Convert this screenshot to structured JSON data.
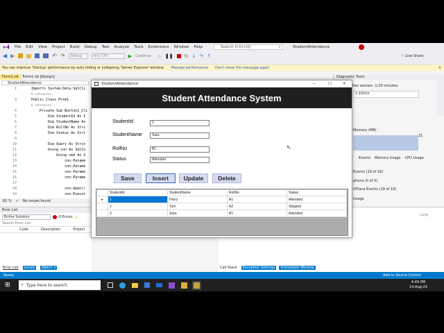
{
  "ide": {
    "menu": [
      "File",
      "Edit",
      "View",
      "Project",
      "Build",
      "Debug",
      "Test",
      "Analyze",
      "Tools",
      "Extensions",
      "Window",
      "Help"
    ],
    "search_placeholder": "Search (Ctrl+Q)",
    "solution_title": "StudentAttendance",
    "live_share": "Live Share",
    "config": "Debug",
    "platform": "Any CPU",
    "continue_label": "Continue",
    "infobar": {
      "message": "You can improve 'Startup' performance by auto hiding or collapsing 'Server Explorer' window.",
      "link1": "Manage performance",
      "link2": "Don't show this message again"
    },
    "tabs": [
      "Form1.vb",
      "Form1.vb [Design]"
    ],
    "code_dropdown": "StudentAttendance",
    "code": {
      "lines": [
        {
          "n": "1",
          "t": "Imports System.Data.SqlCli"
        },
        {
          "n": "",
          "t": "0 references"
        },
        {
          "n": "3",
          "t": "Public Class Form1"
        },
        {
          "n": "",
          "t": "0 references"
        },
        {
          "n": "4",
          "t": "    Private Sub Button1_Cli"
        },
        {
          "n": "5",
          "t": "        Dim StudentId As I"
        },
        {
          "n": "6",
          "t": "        Dim StudentName As"
        },
        {
          "n": "7",
          "t": "        Dim RollNo As Stri"
        },
        {
          "n": "8",
          "t": "        Dim Status As Stri"
        },
        {
          "n": "9",
          "t": ""
        },
        {
          "n": "10",
          "t": "        Dim Query As Strin"
        },
        {
          "n": "11",
          "t": "        Using cnn As SqlCo"
        },
        {
          "n": "12",
          "t": "            Using cmd As S"
        },
        {
          "n": "13",
          "t": "                cnn.Parame"
        },
        {
          "n": "14",
          "t": "                cnn.Parame"
        },
        {
          "n": "15",
          "t": "                cnn.Parame"
        },
        {
          "n": "16",
          "t": "                cnn.Parame"
        },
        {
          "n": "17",
          "t": ""
        },
        {
          "n": "18",
          "t": "                cnn.Open()"
        },
        {
          "n": "19",
          "t": "                cnn.Execut"
        }
      ],
      "zoom": "82 %",
      "issues": "No issues found"
    },
    "error_list": {
      "title": "Error List",
      "scope": "Entire Solution",
      "errors": "0 Errors",
      "search": "Search Error List",
      "cols": [
        "Code",
        "Description",
        "Project"
      ],
      "bottom_tabs": [
        "Error List",
        "Locals",
        "Watch 1"
      ]
    },
    "diagnostics": {
      "title": "Diagnostic Tools",
      "session": "ites session: 1:20 minutes",
      "time": "1:10min",
      "memory": "Memory (MB)",
      "mem_value": "21",
      "tabs": [
        "Events",
        "Memory Usage",
        "CPU Usage"
      ],
      "events": "Events (19 of 19)",
      "exceptions": "ptions (0 of 0)",
      "intellitrace": "lliTrace Events (19 of 19)",
      "usage": "Usage"
    },
    "callstack": {
      "tabs": [
        "Call Stack",
        "Exception Settings",
        "Immediate Window"
      ],
      "lang": "Lang"
    },
    "status": {
      "ready": "Ready",
      "source_control": "Add to Source Control"
    },
    "taskbar": {
      "search": "Type here to search",
      "time": "4:49 PM",
      "date": "14-Aug-23"
    }
  },
  "form": {
    "window_title": "StudentAttendance",
    "header": "Student Attendance System",
    "fields": [
      {
        "label": "StudentId",
        "value": "3"
      },
      {
        "label": "StudentName",
        "value": "Sara"
      },
      {
        "label": "RollNo",
        "value": "B1"
      },
      {
        "label": "Status",
        "value": "Attended"
      }
    ],
    "buttons": [
      "Save",
      "Insert",
      "Update",
      "Delete"
    ],
    "grid": {
      "columns": [
        "StudentId",
        "StudentName",
        "RollNo",
        "Status"
      ],
      "rows": [
        [
          "1",
          "Harry",
          "A1",
          "Attended"
        ],
        [
          "2",
          "Tom",
          "A2",
          "Skipped"
        ],
        [
          "3",
          "Sara",
          "B1",
          "Attended"
        ]
      ]
    }
  },
  "colors": {
    "accent": "#007acc",
    "header": "#1f1f1f",
    "selection": "#0078d7",
    "button": "#d6dcf0"
  }
}
